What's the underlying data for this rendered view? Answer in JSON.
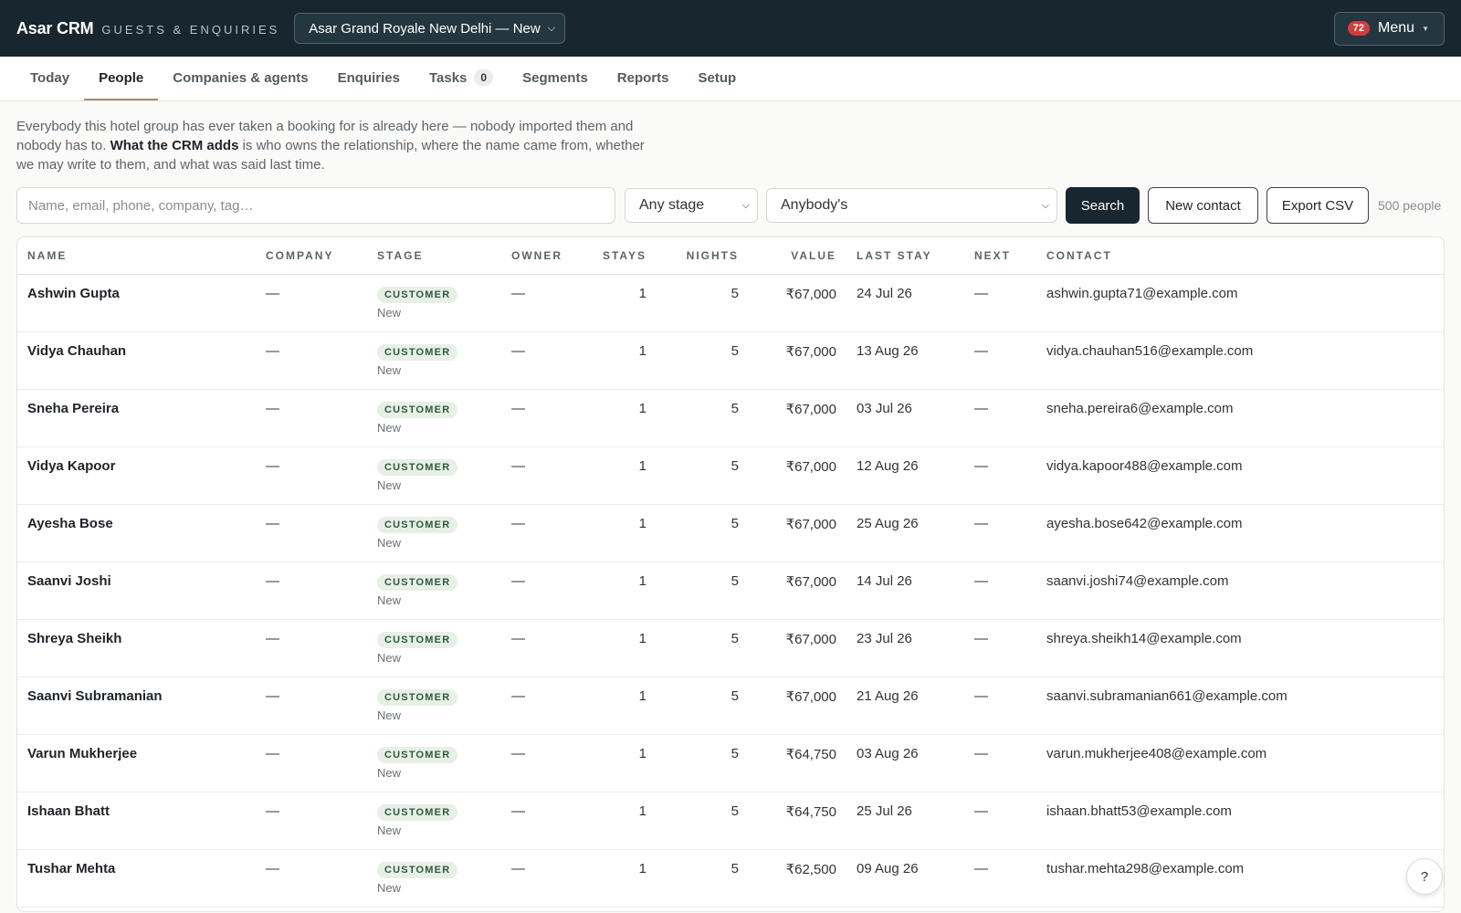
{
  "app": {
    "brand": "Asar CRM",
    "subtitle": "GUESTS & ENQUIRIES",
    "property": "Asar Grand Royale New Delhi — New",
    "menu_badge": "72",
    "menu_label": "Menu"
  },
  "tabs": [
    {
      "label": "Today"
    },
    {
      "label": "People",
      "active": true
    },
    {
      "label": "Companies & agents"
    },
    {
      "label": "Enquiries"
    },
    {
      "label": "Tasks",
      "count": "0"
    },
    {
      "label": "Segments"
    },
    {
      "label": "Reports"
    },
    {
      "label": "Setup"
    }
  ],
  "intro": {
    "part1": "Everybody this hotel group has ever taken a booking for is already here — nobody imported them and nobody has to. ",
    "bold": "What the CRM adds",
    "part2": " is who owns the relationship, where the name came from, whether we may write to them, and what was said last time."
  },
  "filters": {
    "search_placeholder": "Name, email, phone, company, tag…",
    "stage_value": "Any stage",
    "owner_value": "Anybody's",
    "search_button": "Search",
    "new_contact_button": "New contact",
    "export_button": "Export CSV",
    "count_label": "500 people"
  },
  "table": {
    "columns": [
      "NAME",
      "COMPANY",
      "STAGE",
      "OWNER",
      "STAYS",
      "NIGHTS",
      "VALUE",
      "LAST STAY",
      "NEXT",
      "CONTACT"
    ],
    "rows": [
      {
        "name": "Ashwin Gupta",
        "company": "—",
        "stage": "CUSTOMER",
        "stage_sub": "New",
        "owner": "—",
        "stays": "1",
        "nights": "5",
        "value": "₹67,000",
        "last_stay": "24 Jul 26",
        "next": "—",
        "contact": "ashwin.gupta71@example.com"
      },
      {
        "name": "Vidya Chauhan",
        "company": "—",
        "stage": "CUSTOMER",
        "stage_sub": "New",
        "owner": "—",
        "stays": "1",
        "nights": "5",
        "value": "₹67,000",
        "last_stay": "13 Aug 26",
        "next": "—",
        "contact": "vidya.chauhan516@example.com"
      },
      {
        "name": "Sneha Pereira",
        "company": "—",
        "stage": "CUSTOMER",
        "stage_sub": "New",
        "owner": "—",
        "stays": "1",
        "nights": "5",
        "value": "₹67,000",
        "last_stay": "03 Jul 26",
        "next": "—",
        "contact": "sneha.pereira6@example.com"
      },
      {
        "name": "Vidya Kapoor",
        "company": "—",
        "stage": "CUSTOMER",
        "stage_sub": "New",
        "owner": "—",
        "stays": "1",
        "nights": "5",
        "value": "₹67,000",
        "last_stay": "12 Aug 26",
        "next": "—",
        "contact": "vidya.kapoor488@example.com"
      },
      {
        "name": "Ayesha Bose",
        "company": "—",
        "stage": "CUSTOMER",
        "stage_sub": "New",
        "owner": "—",
        "stays": "1",
        "nights": "5",
        "value": "₹67,000",
        "last_stay": "25 Aug 26",
        "next": "—",
        "contact": "ayesha.bose642@example.com"
      },
      {
        "name": "Saanvi Joshi",
        "company": "—",
        "stage": "CUSTOMER",
        "stage_sub": "New",
        "owner": "—",
        "stays": "1",
        "nights": "5",
        "value": "₹67,000",
        "last_stay": "14 Jul 26",
        "next": "—",
        "contact": "saanvi.joshi74@example.com"
      },
      {
        "name": "Shreya Sheikh",
        "company": "—",
        "stage": "CUSTOMER",
        "stage_sub": "New",
        "owner": "—",
        "stays": "1",
        "nights": "5",
        "value": "₹67,000",
        "last_stay": "23 Jul 26",
        "next": "—",
        "contact": "shreya.sheikh14@example.com"
      },
      {
        "name": "Saanvi Subramanian",
        "company": "—",
        "stage": "CUSTOMER",
        "stage_sub": "New",
        "owner": "—",
        "stays": "1",
        "nights": "5",
        "value": "₹67,000",
        "last_stay": "21 Aug 26",
        "next": "—",
        "contact": "saanvi.subramanian661@example.com"
      },
      {
        "name": "Varun Mukherjee",
        "company": "—",
        "stage": "CUSTOMER",
        "stage_sub": "New",
        "owner": "—",
        "stays": "1",
        "nights": "5",
        "value": "₹64,750",
        "last_stay": "03 Aug 26",
        "next": "—",
        "contact": "varun.mukherjee408@example.com"
      },
      {
        "name": "Ishaan Bhatt",
        "company": "—",
        "stage": "CUSTOMER",
        "stage_sub": "New",
        "owner": "—",
        "stays": "1",
        "nights": "5",
        "value": "₹64,750",
        "last_stay": "25 Jul 26",
        "next": "—",
        "contact": "ishaan.bhatt53@example.com"
      },
      {
        "name": "Tushar Mehta",
        "company": "—",
        "stage": "CUSTOMER",
        "stage_sub": "New",
        "owner": "—",
        "stays": "1",
        "nights": "5",
        "value": "₹62,500",
        "last_stay": "09 Aug 26",
        "next": "—",
        "contact": "tushar.mehta298@example.com"
      }
    ]
  },
  "help": {
    "label": "?"
  }
}
